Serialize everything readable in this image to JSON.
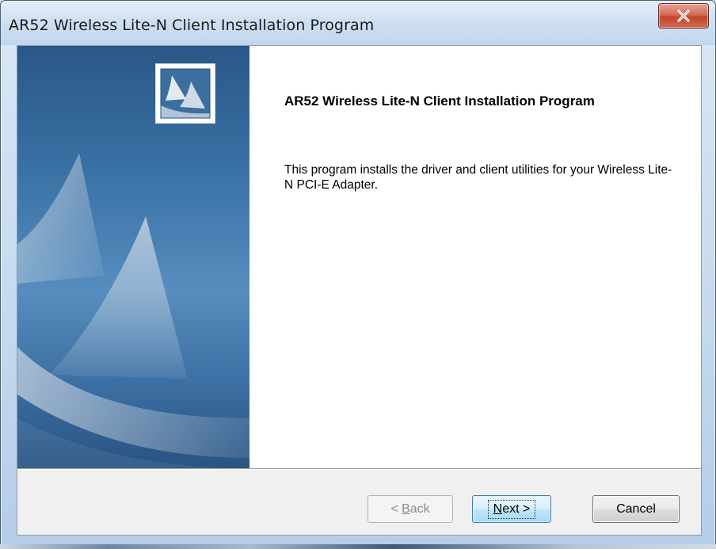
{
  "window": {
    "title": "AR52 Wireless Lite-N Client Installation Program",
    "close_icon": "close-icon"
  },
  "content": {
    "heading": "AR52 Wireless Lite-N Client Installation Program",
    "description": "This program installs the driver and client utilities for your Wireless Lite-N PCI-E Adapter."
  },
  "buttons": {
    "back": {
      "label": "< Back",
      "mnemonic": "B",
      "enabled": false
    },
    "next": {
      "label": "Next >",
      "mnemonic": "N",
      "enabled": true,
      "default": true
    },
    "cancel": {
      "label": "Cancel",
      "enabled": true
    }
  },
  "icons": {
    "logo": "sail-logo-icon",
    "close": "close-icon"
  },
  "colors": {
    "banner_dark": "#2c5b8e",
    "banner_light": "#5b93c6",
    "close_button": "#c2452d",
    "default_button_border": "#3c7fb1"
  }
}
